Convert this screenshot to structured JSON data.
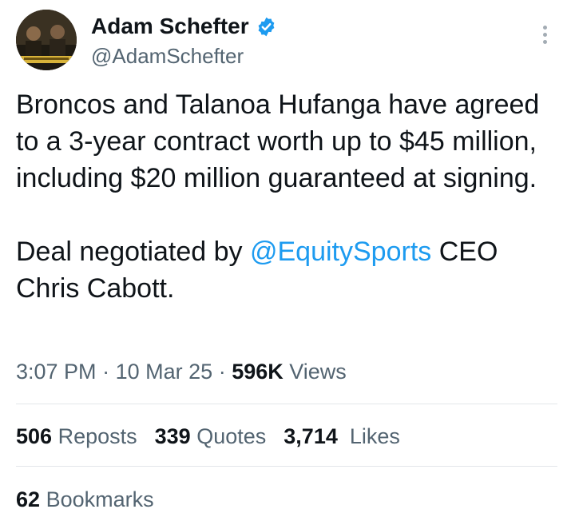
{
  "author": {
    "display_name": "Adam Schefter",
    "handle": "@AdamSchefter",
    "avatar_icon": "avatar-image",
    "verified_icon": "verified-badge-icon"
  },
  "tweet": {
    "p1": "Broncos and Talanoa Hufanga have agreed to a 3-year contract worth up to $45 million, including $20 million guaranteed at signing.",
    "p2_prefix": "Deal negotiated by ",
    "p2_mention": "@EquitySports",
    "p2_suffix": " CEO Chris Cabott."
  },
  "meta": {
    "time": "3:07 PM",
    "sep1": "·",
    "date": "10 Mar 25",
    "sep2": "·",
    "views_count": "596K",
    "views_label": "Views"
  },
  "stats": {
    "reposts_count": "506",
    "reposts_label": "Reposts",
    "quotes_count": "339",
    "quotes_label": "Quotes",
    "likes_count": "3,714",
    "likes_label": "Likes",
    "bookmarks_count": "62",
    "bookmarks_label": "Bookmarks"
  },
  "colors": {
    "link": "#1d9bf0",
    "text": "#0f1419",
    "secondary": "#536471"
  }
}
